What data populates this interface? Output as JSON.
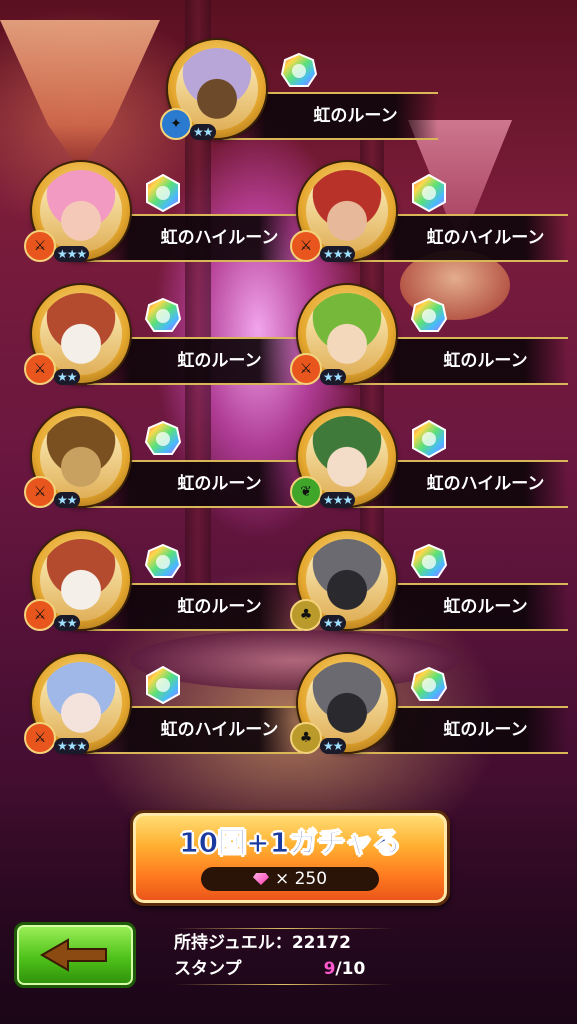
{
  "results": [
    {
      "name": "虹のルーン",
      "rune": "rainbow",
      "stars": 2,
      "element": "water",
      "character": "dark-skinned elf"
    },
    {
      "name": "虹のハイルーン",
      "rune": "rainbow-high",
      "stars": 3,
      "element": "fire",
      "character": "pink-haired girl"
    },
    {
      "name": "虹のハイルーン",
      "rune": "rainbow-high",
      "stars": 3,
      "element": "fire",
      "character": "red-haired man with goggles"
    },
    {
      "name": "虹のルーン",
      "rune": "rainbow",
      "stars": 2,
      "element": "fire",
      "character": "white owl cat"
    },
    {
      "name": "虹のルーン",
      "rune": "rainbow",
      "stars": 2,
      "element": "fire",
      "character": "green-haired boy"
    },
    {
      "name": "虹のルーン",
      "rune": "rainbow",
      "stars": 2,
      "element": "fire",
      "character": "brown cat"
    },
    {
      "name": "虹のハイルーン",
      "rune": "rainbow-high",
      "stars": 3,
      "element": "wind",
      "character": "green-haired girl"
    },
    {
      "name": "虹のルーン",
      "rune": "rainbow",
      "stars": 2,
      "element": "fire",
      "character": "white owl cat"
    },
    {
      "name": "虹のルーン",
      "rune": "rainbow",
      "stars": 2,
      "element": "earth",
      "character": "black cat"
    },
    {
      "name": "虹のハイルーン",
      "rune": "rainbow-high",
      "stars": 3,
      "element": "fire",
      "character": "blue-haired girl"
    },
    {
      "name": "虹のルーン",
      "rune": "rainbow",
      "stars": 2,
      "element": "earth",
      "character": "black cat"
    }
  ],
  "gacha_button": {
    "label": "10回+1ガチャる",
    "cost": "× 250"
  },
  "info": {
    "jewel_label": "所持ジュエル：",
    "jewel_value": "22172",
    "stamp_label": "スタンプ",
    "stamp_value": "9",
    "stamp_total": "/10"
  },
  "colors": {
    "fire": "#e8561e",
    "water": "#2a7ad0",
    "wind": "#3fa62a",
    "earth": "#b99a2a",
    "gold": "#d9b657"
  }
}
